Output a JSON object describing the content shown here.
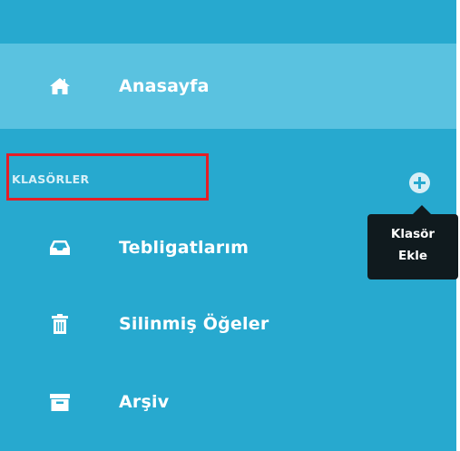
{
  "sidebar": {
    "home": {
      "label": "Anasayfa",
      "icon": "home-icon"
    },
    "section": {
      "label": "KLASÖRLER",
      "add_icon": "plus-circle-icon"
    },
    "tooltip": {
      "line1": "Klasör",
      "line2": "Ekle"
    },
    "items": [
      {
        "label": "Tebligatlarım",
        "icon": "inbox-icon"
      },
      {
        "label": "Silinmiş Öğeler",
        "icon": "trash-icon"
      },
      {
        "label": "Arşiv",
        "icon": "archive-icon"
      }
    ]
  },
  "colors": {
    "sidebar_bg": "#27a9cf",
    "active_bg": "#5ac2e0",
    "highlight": "#e41e26",
    "tooltip_bg": "#101a1e"
  }
}
